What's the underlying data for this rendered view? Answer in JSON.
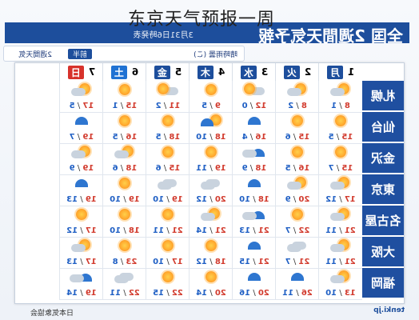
{
  "overlay_title": "东京天气预报一周",
  "header": {
    "title_line": "全国 2週間天気予報",
    "date": "3月31日6時発表",
    "tabs": [
      "前半",
      "2週間天気"
    ],
    "notes": "晴時雨曇 (こ)"
  },
  "days": [
    {
      "day": "1",
      "wd": "月",
      "color": "#1d4e9c"
    },
    {
      "day": "2",
      "wd": "火",
      "color": "#1d4e9c"
    },
    {
      "day": "3",
      "wd": "水",
      "color": "#1d4e9c"
    },
    {
      "day": "4",
      "wd": "木",
      "color": "#1d4e9c"
    },
    {
      "day": "5",
      "wd": "金",
      "color": "#1d4e9c"
    },
    {
      "day": "6",
      "wd": "土",
      "color": "#2072d3"
    },
    {
      "day": "7",
      "wd": "日",
      "color": "#d7322b"
    }
  ],
  "cities": [
    {
      "name": "札幌",
      "cells": [
        {
          "icon": "sun-cloud",
          "hi": "8",
          "lo": "1"
        },
        {
          "icon": "sun-cloud",
          "hi": "8",
          "lo": "2"
        },
        {
          "icon": "cloud-sun",
          "hi": "12",
          "lo": "0"
        },
        {
          "icon": "sun",
          "hi": "9",
          "lo": "5"
        },
        {
          "icon": "cloud-sun",
          "hi": "11",
          "lo": "2"
        },
        {
          "icon": "sun",
          "hi": "15",
          "lo": "1"
        },
        {
          "icon": "sun-cloud",
          "hi": "17",
          "lo": "5"
        }
      ]
    },
    {
      "name": "仙台",
      "cells": [
        {
          "icon": "sun",
          "hi": "15",
          "lo": "5"
        },
        {
          "icon": "sun",
          "hi": "15",
          "lo": "6"
        },
        {
          "icon": "rain",
          "hi": "16",
          "lo": "4"
        },
        {
          "icon": "sun-rain",
          "hi": "18",
          "lo": "10"
        },
        {
          "icon": "sun",
          "hi": "18",
          "lo": "5"
        },
        {
          "icon": "sun",
          "hi": "16",
          "lo": "5"
        },
        {
          "icon": "rain",
          "hi": "19",
          "lo": "7"
        }
      ]
    },
    {
      "name": "金沢",
      "cells": [
        {
          "icon": "sun",
          "hi": "15",
          "lo": "7"
        },
        {
          "icon": "sun",
          "hi": "16",
          "lo": "5"
        },
        {
          "icon": "rain-cloud",
          "hi": "18",
          "lo": "9"
        },
        {
          "icon": "sun",
          "hi": "19",
          "lo": "11"
        },
        {
          "icon": "sun",
          "hi": "15",
          "lo": "6"
        },
        {
          "icon": "sun-cloud",
          "hi": "18",
          "lo": "6"
        },
        {
          "icon": "sun-cloud",
          "hi": "19",
          "lo": "9"
        }
      ]
    },
    {
      "name": "東京",
      "cells": [
        {
          "icon": "sun-cloud",
          "hi": "17",
          "lo": "12"
        },
        {
          "icon": "sun-cloud",
          "hi": "20",
          "lo": "9"
        },
        {
          "icon": "rain",
          "hi": "18",
          "lo": "10"
        },
        {
          "icon": "cloud",
          "hi": "20",
          "lo": "12"
        },
        {
          "icon": "cloud",
          "hi": "19",
          "lo": "10"
        },
        {
          "icon": "sun",
          "hi": "19",
          "lo": "10"
        },
        {
          "icon": "rain",
          "hi": "19",
          "lo": "13"
        }
      ]
    },
    {
      "name": "名古屋",
      "cells": [
        {
          "icon": "sun-cloud",
          "hi": "21",
          "lo": "11"
        },
        {
          "icon": "sun",
          "hi": "22",
          "lo": "7"
        },
        {
          "icon": "rain-cloud",
          "hi": "21",
          "lo": "13"
        },
        {
          "icon": "sun-cloud",
          "hi": "21",
          "lo": "14"
        },
        {
          "icon": "sun",
          "hi": "21",
          "lo": "11"
        },
        {
          "icon": "sun",
          "hi": "18",
          "lo": "10"
        },
        {
          "icon": "sun",
          "hi": "17",
          "lo": "12"
        }
      ]
    },
    {
      "name": "大阪",
      "cells": [
        {
          "icon": "sun-cloud",
          "hi": "21",
          "lo": "11"
        },
        {
          "icon": "cloud",
          "hi": "21",
          "lo": "7"
        },
        {
          "icon": "rain",
          "hi": "21",
          "lo": "15"
        },
        {
          "icon": "sun",
          "hi": "18",
          "lo": "12"
        },
        {
          "icon": "sun",
          "hi": "17",
          "lo": "10"
        },
        {
          "icon": "sun",
          "hi": "23",
          "lo": "8"
        },
        {
          "icon": "sun-cloud",
          "hi": "17",
          "lo": "13"
        }
      ]
    },
    {
      "name": "福岡",
      "cells": [
        {
          "icon": "sun-cloud",
          "hi": "13",
          "lo": "10"
        },
        {
          "icon": "rain",
          "hi": "26",
          "lo": "11"
        },
        {
          "icon": "rain",
          "hi": "20",
          "lo": "16"
        },
        {
          "icon": "sun",
          "hi": "20",
          "lo": "14"
        },
        {
          "icon": "sun",
          "hi": "22",
          "lo": "15"
        },
        {
          "icon": "cloud",
          "hi": "22",
          "lo": "11"
        },
        {
          "icon": "rain-cloud",
          "hi": "19",
          "lo": "14"
        }
      ]
    }
  ],
  "footer": {
    "logo": "tenki.jp",
    "org": "日本気象協会"
  }
}
